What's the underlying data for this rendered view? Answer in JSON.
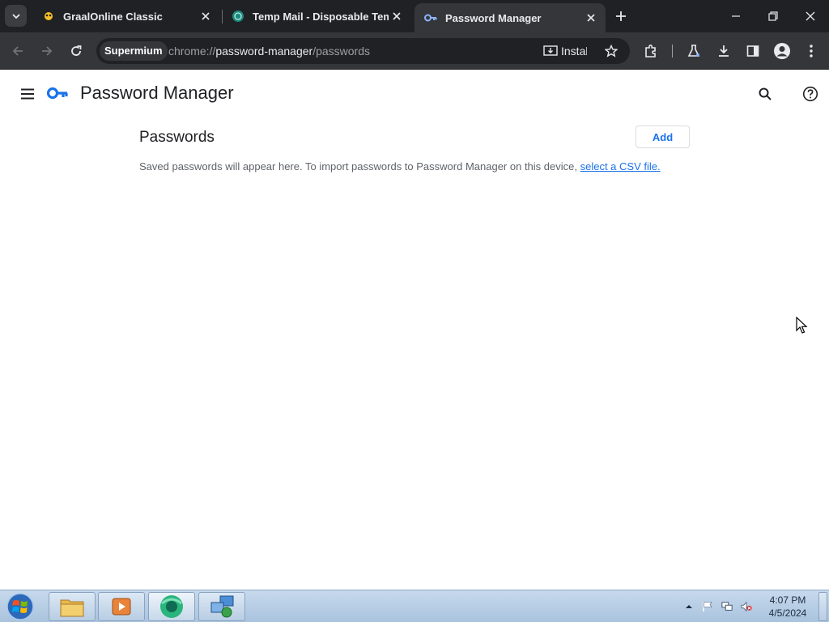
{
  "tabs": [
    {
      "title": "GraalOnline Classic",
      "favicon": "graal-favicon-icon",
      "active": false
    },
    {
      "title": "Temp Mail - Disposable Tempo",
      "favicon": "tempmail-favicon-icon",
      "active": false
    },
    {
      "title": "Password Manager",
      "favicon": "key-icon",
      "active": true
    }
  ],
  "toolbar": {
    "origin_chip": "Supermium",
    "url_scheme": "chrome://",
    "url_host": "password-manager",
    "url_path": "/passwords",
    "install_label": "Install"
  },
  "page": {
    "app_title": "Password Manager",
    "section_title": "Passwords",
    "add_label": "Add",
    "empty_message": "Saved passwords will appear here. To import passwords to Password Manager on this device,",
    "csv_link": "select a CSV file."
  },
  "taskbar": {
    "time": "4:07 PM",
    "date": "4/5/2024"
  },
  "colors": {
    "tabstrip_bg": "#202124",
    "toolbar_bg": "#35363a",
    "accent_blue": "#1a73e8",
    "taskbar_bg": "#b8cde3"
  }
}
